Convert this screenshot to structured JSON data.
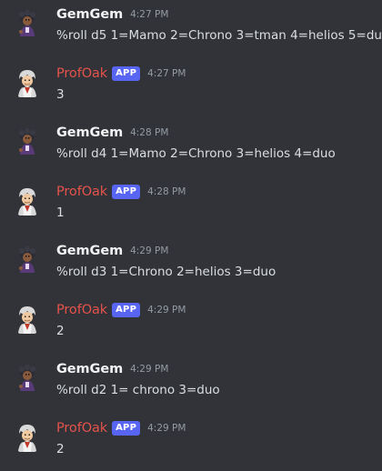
{
  "messages": [
    {
      "author": "GemGem",
      "app_badge": "",
      "time": "4:27 PM",
      "text": "%roll d5 1=Mamo 2=Chrono 3=tman 4=helios 5=duo"
    },
    {
      "author": "ProfOak",
      "app_badge": "APP",
      "time": "4:27 PM",
      "text": "3"
    },
    {
      "author": "GemGem",
      "app_badge": "",
      "time": "4:28 PM",
      "text": "%roll d4 1=Mamo 2=Chrono 3=helios 4=duo"
    },
    {
      "author": "ProfOak",
      "app_badge": "APP",
      "time": "4:28 PM",
      "text": "1"
    },
    {
      "author": "GemGem",
      "app_badge": "",
      "time": "4:29 PM",
      "text": "%roll d3 1=Chrono 2=helios 3=duo"
    },
    {
      "author": "ProfOak",
      "app_badge": "APP",
      "time": "4:29 PM",
      "text": "2"
    },
    {
      "author": "GemGem",
      "app_badge": "",
      "time": "4:29 PM",
      "text": "%roll d2 1= chrono 3=duo"
    },
    {
      "author": "ProfOak",
      "app_badge": "APP",
      "time": "4:29 PM",
      "text": "2"
    }
  ],
  "icons": {
    "user_avatar": "trainer-avatar-icon",
    "bot_avatar": "prof-oak-avatar-icon"
  },
  "colors": {
    "background": "#313338",
    "bot_name": "#e5534b",
    "app_badge": "#5865f2",
    "timestamp": "#949ba4",
    "message_text": "#dbdee1"
  }
}
